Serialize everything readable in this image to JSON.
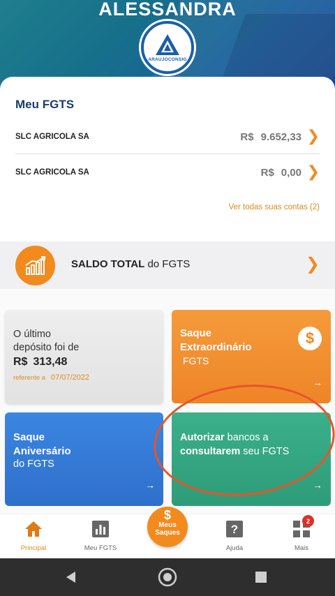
{
  "header": {
    "user_name": "ALESSANDRA",
    "logo_text": "ARAUJOCONSIG"
  },
  "fgts": {
    "title": "Meu FGTS",
    "accounts": [
      {
        "company": "SLC AGRICOLA SA",
        "currency": "R$",
        "amount": "9.652,33"
      },
      {
        "company": "SLC AGRICOLA SA",
        "currency": "R$",
        "amount": "0,00"
      }
    ],
    "see_all": "Ver todas suas contas (2)"
  },
  "saldo": {
    "bold": "SALDO TOTAL",
    "rest": " do FGTS"
  },
  "tiles": {
    "last_deposit": {
      "line1": "O último",
      "line2": "depósito foi de",
      "currency": "R$",
      "amount": "313,48",
      "ref_label": "referente a",
      "ref_date": "07/07/2022"
    },
    "saque_extraordinario": {
      "title_line1": "Saque",
      "title_line2": "Extraordinário",
      "sub": "FGTS",
      "icon_symbol": "$"
    },
    "saque_aniversario": {
      "title_line1": "Saque",
      "title_line2": "Aniversário",
      "sub": "do FGTS"
    },
    "autorizar": {
      "b1": "Autorizar",
      "t1": " bancos a",
      "b2": "consultarem",
      "t2": " seu FGTS"
    },
    "arrow": "→"
  },
  "nav": {
    "items": [
      {
        "label": "Principal",
        "icon": "home-icon"
      },
      {
        "label": "Meu FGTS",
        "icon": "bar-chart-icon"
      },
      {
        "label": "Ajuda",
        "icon": "help-icon"
      },
      {
        "label": "Mais",
        "icon": "grid-icon"
      }
    ],
    "fab": {
      "symbol": "$",
      "line1": "Meus",
      "line2": "Saques"
    },
    "badge_count": "2"
  },
  "colors": {
    "accent": "#f28a1e",
    "navy": "#1a3c6e",
    "blue_tile": "#2f6fcc",
    "green_tile": "#2e9c78"
  }
}
